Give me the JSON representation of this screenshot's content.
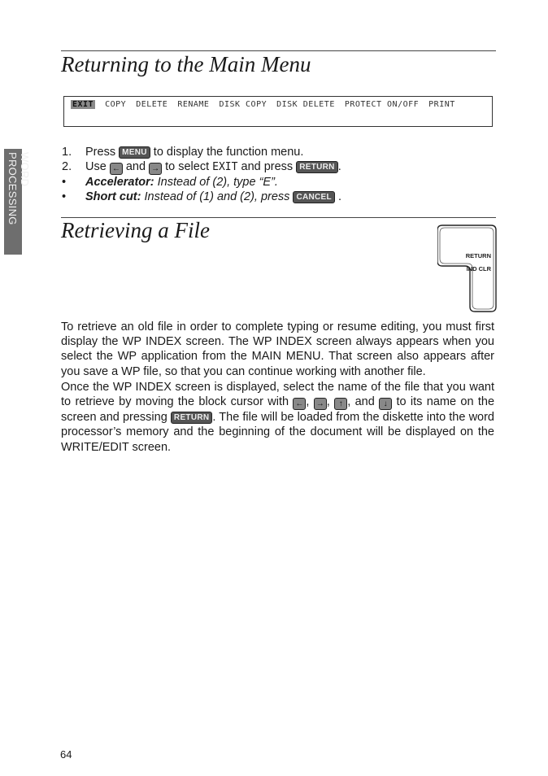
{
  "side_tab": {
    "label": "WORD PROCESSING",
    "color": "#6e6e6e"
  },
  "section1": {
    "title": "Returning to the Main Menu",
    "function_menu": {
      "items": [
        "EXIT",
        "COPY",
        "DELETE",
        "RENAME",
        "DISK COPY",
        "DISK DELETE",
        "PROTECT ON/OFF",
        "PRINT"
      ],
      "selected": "EXIT"
    },
    "steps": [
      {
        "num": "1.",
        "before": "Press",
        "key": "MENU",
        "after": "to display the function menu."
      },
      {
        "num": "2.",
        "before": "Use",
        "key_left": "←",
        "mid1": "and",
        "key_right": "→",
        "mid2": "to select",
        "code": "EXIT",
        "mid3": "and press",
        "key": "RETURN",
        "after": "."
      }
    ],
    "tips": [
      {
        "label": "Accelerator:",
        "text": "Instead of (2), type “E”."
      },
      {
        "label": "Short cut:",
        "text": "Instead of (1) and (2), press",
        "key": "CANCEL",
        "after": "."
      }
    ]
  },
  "section2": {
    "title": "Retrieving a File",
    "key_illustration": {
      "line1": "RETURN",
      "line2": "IND CLR"
    },
    "para1": "To retrieve an old file in order to complete typing or resume editing, you must first display the WP INDEX screen. The WP INDEX screen always appears when you select the WP application from the MAIN MENU. That screen also appears after you save a WP file, so that you can continue working with another file.",
    "para2": {
      "part1": "Once the WP INDEX screen is displayed, select the name of the file that you want to retrieve by moving the block cursor with",
      "keys": [
        "←",
        "→",
        "↑",
        "↓"
      ],
      "sep1": ",",
      "sep2": ",",
      "sep3": ", and",
      "part2": "to its name on the screen and pressing",
      "key": "RETURN",
      "part3": ". The file will be loaded from the diskette into the word processor’s memory and the beginning of the document will be displayed on the WRITE/EDIT screen."
    }
  },
  "footer": {
    "page_number": "64"
  }
}
